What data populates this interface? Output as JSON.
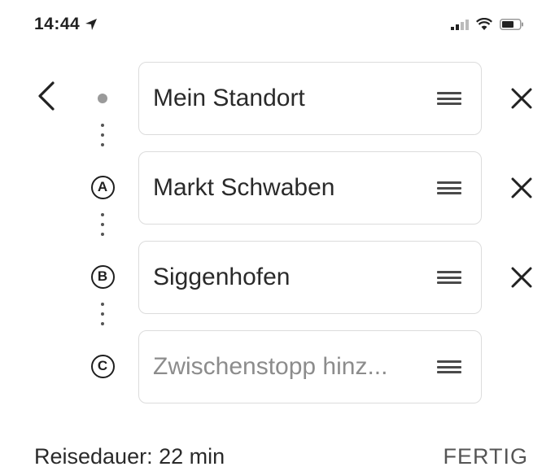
{
  "status_bar": {
    "time": "14:44",
    "icons": [
      "location-arrow-icon",
      "signal-icon",
      "wifi-icon",
      "battery-icon"
    ]
  },
  "navigation": {
    "back_icon": "chevron-left-icon"
  },
  "stops": [
    {
      "marker": "",
      "marker_icon": "current-location-dot-icon",
      "value": "Mein Standort",
      "removable": true
    },
    {
      "marker": "A",
      "value": "Markt Schwaben",
      "removable": true
    },
    {
      "marker": "B",
      "value": "Siggenhofen",
      "removable": true
    },
    {
      "marker": "C",
      "value": "",
      "placeholder": "Zwischenstopp hinz...",
      "removable": false
    }
  ],
  "footer": {
    "duration": "Reisedauer: 22 min",
    "done_label": "FERTIG"
  },
  "colors": {
    "field_border": "#dcdcdc",
    "placeholder": "#8c8c8c",
    "text": "#2a2a2a",
    "marker_dot": "#9a9a9a"
  }
}
